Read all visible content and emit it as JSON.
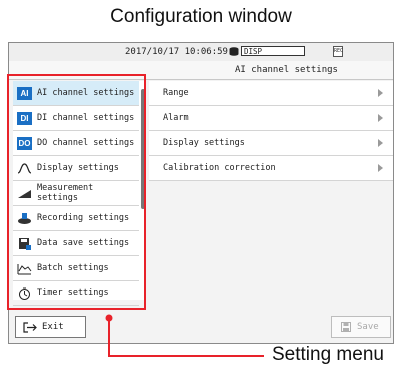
{
  "caption_top": "Configuration window",
  "caption_bottom": "Setting menu",
  "status": {
    "timestamp": "2017/10/17 10:06:59",
    "display_field": "DISP",
    "mini_icon_text": "REC"
  },
  "panel_title": "AI channel settings",
  "menu_items": [
    {
      "label": "AI channel settings",
      "badge": "AI",
      "icon": "ai-badge-icon"
    },
    {
      "label": "DI channel settings",
      "badge": "DI",
      "icon": "di-badge-icon"
    },
    {
      "label": "DO channel settings",
      "badge": "DO",
      "icon": "do-badge-icon"
    },
    {
      "label": "Display settings",
      "icon": "waveform-icon"
    },
    {
      "label": "Measurement settings",
      "icon": "measurement-icon"
    },
    {
      "label": "Recording settings",
      "icon": "recording-icon"
    },
    {
      "label": "Data save settings",
      "icon": "save-disk-icon"
    },
    {
      "label": "Batch settings",
      "icon": "batch-icon"
    },
    {
      "label": "Timer settings",
      "icon": "timer-icon"
    }
  ],
  "right_items": [
    {
      "label": "Range"
    },
    {
      "label": "Alarm"
    },
    {
      "label": "Display settings"
    },
    {
      "label": "Calibration correction"
    }
  ],
  "buttons": {
    "exit_label": "Exit",
    "save_label": "Save"
  },
  "colors": {
    "accent": "#1a6fc4",
    "selected_row": "#d6ecf8",
    "callout": "#e8222a"
  }
}
